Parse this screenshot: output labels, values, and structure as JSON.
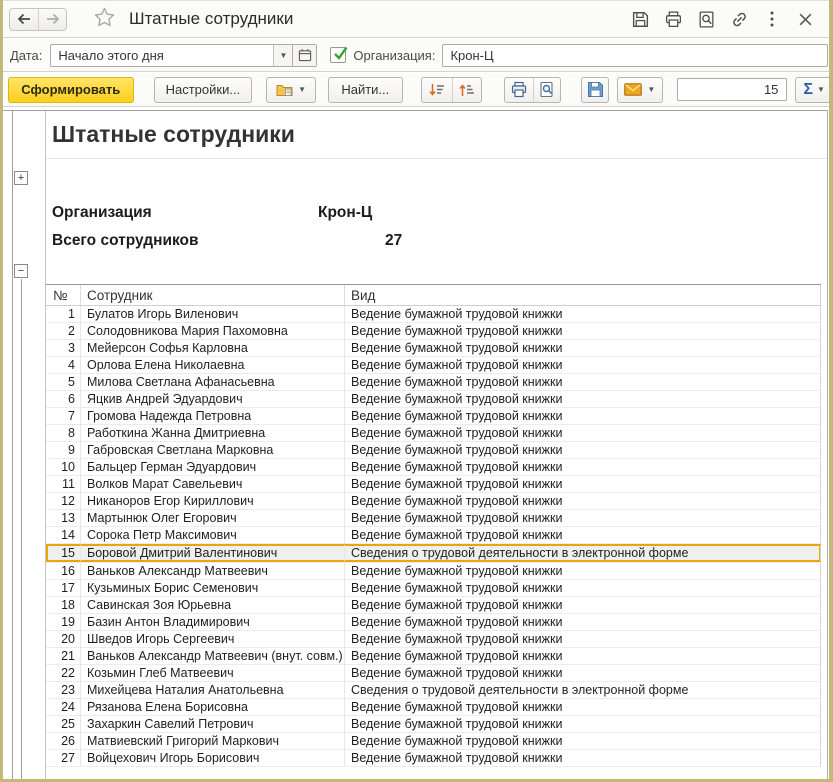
{
  "titlebar": {
    "title": "Штатные сотрудники",
    "icons": [
      "back",
      "forward",
      "favorite-star",
      "save",
      "print",
      "print-preview",
      "link",
      "more",
      "close"
    ]
  },
  "params": {
    "date_label": "Дата:",
    "date_value": "Начало этого дня",
    "org_checkbox_checked": true,
    "org_label": "Организация:",
    "org_value": "Крон-Ц"
  },
  "toolbar": {
    "generate_label": "Сформировать",
    "settings_label": "Настройки...",
    "find_label": "Найти...",
    "count_value": "15",
    "sigma_label": "Σ"
  },
  "report": {
    "title": "Штатные сотрудники",
    "org_label": "Организация",
    "org_value": "Крон-Ц",
    "total_label": "Всего сотрудников",
    "total_value": "27"
  },
  "table": {
    "columns": [
      "№",
      "Сотрудник",
      "Вид"
    ],
    "highlighted_row": 15,
    "rows": [
      {
        "num": 1,
        "name": "Булатов Игорь Виленович",
        "kind": "Ведение бумажной трудовой книжки"
      },
      {
        "num": 2,
        "name": "Солодовникова Мария Пахомовна",
        "kind": "Ведение бумажной трудовой книжки"
      },
      {
        "num": 3,
        "name": "Мейерсон Софья Карловна",
        "kind": "Ведение бумажной трудовой книжки"
      },
      {
        "num": 4,
        "name": "Орлова Елена Николаевна",
        "kind": "Ведение бумажной трудовой книжки"
      },
      {
        "num": 5,
        "name": "Милова Светлана Афанасьевна",
        "kind": "Ведение бумажной трудовой книжки"
      },
      {
        "num": 6,
        "name": "Яцкив Андрей Эдуардович",
        "kind": "Ведение бумажной трудовой книжки"
      },
      {
        "num": 7,
        "name": "Громова Надежда Петровна",
        "kind": "Ведение бумажной трудовой книжки"
      },
      {
        "num": 8,
        "name": "Работкина Жанна Дмитриевна",
        "kind": "Ведение бумажной трудовой книжки"
      },
      {
        "num": 9,
        "name": "Габровская Светлана Марковна",
        "kind": "Ведение бумажной трудовой книжки"
      },
      {
        "num": 10,
        "name": "Бальцер Герман Эдуардович",
        "kind": "Ведение бумажной трудовой книжки"
      },
      {
        "num": 11,
        "name": "Волков Марат Савельевич",
        "kind": "Ведение бумажной трудовой книжки"
      },
      {
        "num": 12,
        "name": "Никаноров Егор Кириллович",
        "kind": "Ведение бумажной трудовой книжки"
      },
      {
        "num": 13,
        "name": "Мартынюк Олег Егорович",
        "kind": "Ведение бумажной трудовой книжки"
      },
      {
        "num": 14,
        "name": "Сорока Петр Максимович",
        "kind": "Ведение бумажной трудовой книжки"
      },
      {
        "num": 15,
        "name": "Боровой Дмитрий Валентинович",
        "kind": "Сведения о трудовой деятельности в электронной форме"
      },
      {
        "num": 16,
        "name": "Ваньков Александр Матвеевич",
        "kind": "Ведение бумажной трудовой книжки"
      },
      {
        "num": 17,
        "name": "Кузьминых Борис Семенович",
        "kind": "Ведение бумажной трудовой книжки"
      },
      {
        "num": 18,
        "name": "Савинская Зоя Юрьевна",
        "kind": "Ведение бумажной трудовой книжки"
      },
      {
        "num": 19,
        "name": "Базин Антон Владимирович",
        "kind": "Ведение бумажной трудовой книжки"
      },
      {
        "num": 20,
        "name": "Шведов Игорь Сергеевич",
        "kind": "Ведение бумажной трудовой книжки"
      },
      {
        "num": 21,
        "name": "Ваньков Александр Матвеевич (внут. совм.)",
        "kind": "Ведение бумажной трудовой книжки"
      },
      {
        "num": 22,
        "name": "Козьмин Глеб Матвеевич",
        "kind": "Ведение бумажной трудовой книжки"
      },
      {
        "num": 23,
        "name": "Михейцева Наталия Анатольевна",
        "kind": "Сведения о трудовой деятельности в электронной форме"
      },
      {
        "num": 24,
        "name": "Рязанова Елена Борисовна",
        "kind": "Ведение бумажной трудовой книжки"
      },
      {
        "num": 25,
        "name": "Захаркин Савелий Петрович",
        "kind": "Ведение бумажной трудовой книжки"
      },
      {
        "num": 26,
        "name": "Матвиевский Григорий Маркович",
        "kind": "Ведение бумажной трудовой книжки"
      },
      {
        "num": 27,
        "name": "Войцехович Игорь Борисович",
        "kind": "Ведение бумажной трудовой книжки"
      }
    ]
  },
  "colors": {
    "report_title_green": "#16a24b",
    "generate_button_yellow": "#fdd01a",
    "highlight_border": "#e8a60a",
    "window_frame_olive": "#c2b878"
  }
}
